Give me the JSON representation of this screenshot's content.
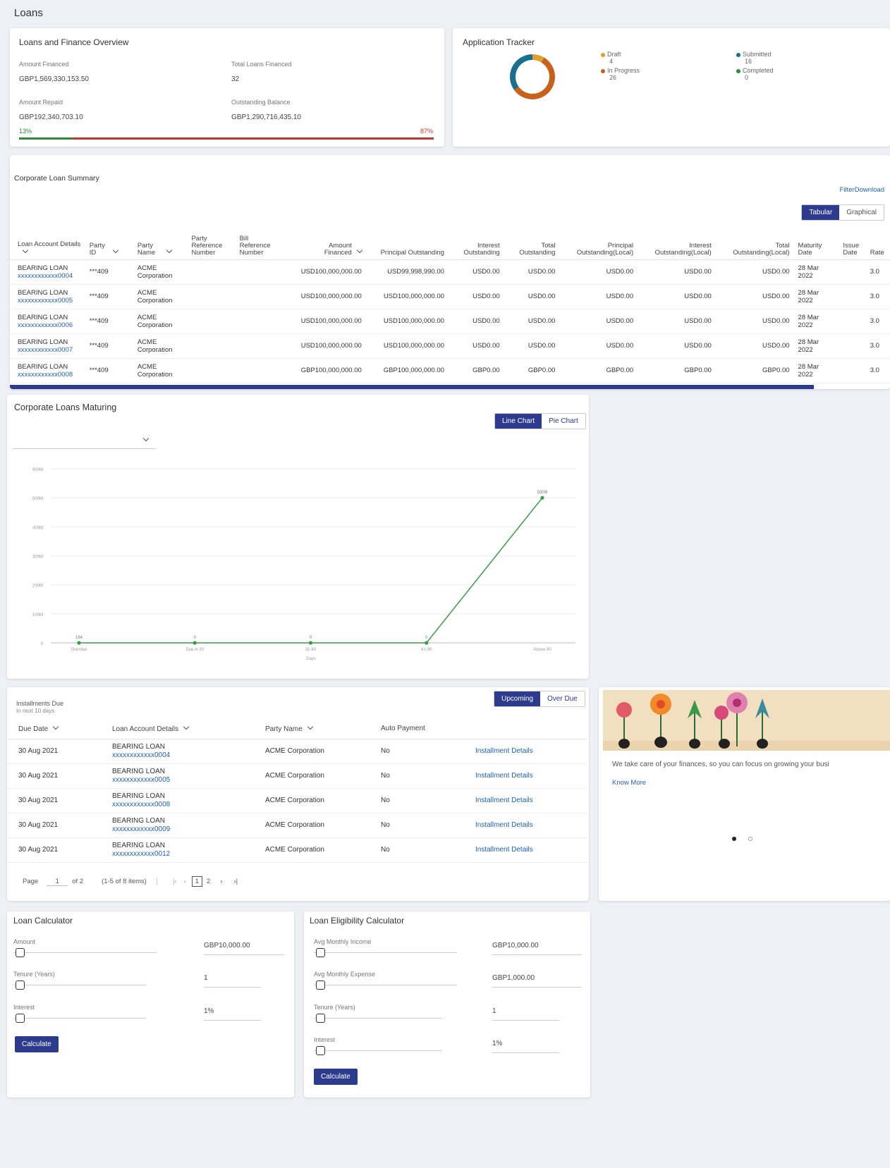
{
  "page": {
    "title": "Loans"
  },
  "overview": {
    "title": "Loans and Finance Overview",
    "amount_financed_label": "Amount Financed",
    "amount_financed": "GBP1,569,330,153.50",
    "total_loans_label": "Total Loans Financed",
    "total_loans": "32",
    "amount_repaid_label": "Amount Repaid",
    "amount_repaid": "GBP192,340,703.10",
    "outstanding_label": "Outstanding Balance",
    "outstanding": "GBP1,290,716,435.10",
    "repaid_pct": "13%",
    "outstanding_pct": "87%",
    "repaid_fraction": 0.13,
    "repaid_color": "#2e8b3a",
    "outstanding_color": "#c0392b"
  },
  "tracker": {
    "title": "Application Tracker",
    "items": [
      {
        "label": "Draft",
        "value": "4",
        "color": "#e0a030",
        "count": 4
      },
      {
        "label": "In Progress",
        "value": "26",
        "color": "#c8621a",
        "count": 26
      },
      {
        "label": "Submitted",
        "value": "16",
        "color": "#1a6f8f",
        "count": 16
      },
      {
        "label": "Completed",
        "value": "0",
        "color": "#2e8b3a",
        "count": 0
      }
    ]
  },
  "summary": {
    "title": "Corporate Loan Summary",
    "filter": "Filter",
    "download": "Download",
    "view_tabular": "Tabular",
    "view_graphical": "Graphical",
    "columns": [
      "Loan Account Details",
      "Party ID",
      "Party Name",
      "Party Reference Number",
      "Bill Reference Number",
      "Amount Financed",
      "Principal Outstanding",
      "Interest Outstanding",
      "Total Outstanding",
      "Principal Outstanding(Local)",
      "Interest Outstanding(Local)",
      "Total Outstanding(Local)",
      "Maturity Date",
      "Issue Date",
      "Rate"
    ],
    "rows": [
      {
        "name": "BEARING LOAN",
        "acct": "xxxxxxxxxxxx0004",
        "party_id": "***409",
        "party_name": "ACME Corporation",
        "amount": "USD100,000,000.00",
        "principal": "USD99,998,990.00",
        "interest": "USD0.00",
        "total": "USD0.00",
        "principal_local": "USD0.00",
        "interest_local": "USD0.00",
        "total_local": "USD0.00",
        "maturity": "28 Mar 2022",
        "rate": "3.0"
      },
      {
        "name": "BEARING LOAN",
        "acct": "xxxxxxxxxxxx0005",
        "party_id": "***409",
        "party_name": "ACME Corporation",
        "amount": "USD100,000,000.00",
        "principal": "USD100,000,000.00",
        "interest": "USD0.00",
        "total": "USD0.00",
        "principal_local": "USD0.00",
        "interest_local": "USD0.00",
        "total_local": "USD0.00",
        "maturity": "28 Mar 2022",
        "rate": "3.0"
      },
      {
        "name": "BEARING LOAN",
        "acct": "xxxxxxxxxxxx0006",
        "party_id": "***409",
        "party_name": "ACME Corporation",
        "amount": "USD100,000,000.00",
        "principal": "USD100,000,000.00",
        "interest": "USD0.00",
        "total": "USD0.00",
        "principal_local": "USD0.00",
        "interest_local": "USD0.00",
        "total_local": "USD0.00",
        "maturity": "28 Mar 2022",
        "rate": "3.0"
      },
      {
        "name": "BEARING LOAN",
        "acct": "xxxxxxxxxxxx0007",
        "party_id": "***409",
        "party_name": "ACME Corporation",
        "amount": "USD100,000,000.00",
        "principal": "USD100,000,000.00",
        "interest": "USD0.00",
        "total": "USD0.00",
        "principal_local": "USD0.00",
        "interest_local": "USD0.00",
        "total_local": "USD0.00",
        "maturity": "28 Mar 2022",
        "rate": "3.0"
      },
      {
        "name": "BEARING LOAN",
        "acct": "xxxxxxxxxxxx0008",
        "party_id": "***409",
        "party_name": "ACME Corporation",
        "amount": "GBP100,000,000.00",
        "principal": "GBP100,000,000.00",
        "interest": "GBP0.00",
        "total": "GBP0.00",
        "principal_local": "GBP0.00",
        "interest_local": "GBP0.00",
        "total_local": "GBP0.00",
        "maturity": "28 Mar 2022",
        "rate": "3.0"
      }
    ]
  },
  "maturing": {
    "title": "Corporate Loans Maturing",
    "line_chart": "Line Chart",
    "pie_chart": "Pie Chart",
    "dropdown_value": ""
  },
  "chart_data": {
    "type": "line",
    "categories": [
      "Overdue",
      "Due in 30",
      "31-60",
      "61-90",
      "Above 90"
    ],
    "values": [
      0.000184,
      0,
      0,
      0,
      500
    ],
    "data_labels": [
      "184",
      "0",
      "0",
      "0",
      "500M"
    ],
    "yticks": [
      "0",
      "100M",
      "200M",
      "300M",
      "400M",
      "500M",
      "600M"
    ],
    "ylim": [
      0,
      600
    ],
    "xlabel": "Days",
    "ylabel": "",
    "series_color": "#3a9a4a",
    "grid": true
  },
  "installments": {
    "title": "Installments Due",
    "subtitle": "In next 10 days",
    "tab_upcoming": "Upcoming",
    "tab_overdue": "Over Due",
    "columns": [
      "Due Date",
      "Loan Account Details",
      "Party Name",
      "Auto Payment"
    ],
    "rows": [
      {
        "date": "30 Aug 2021",
        "name": "BEARING LOAN",
        "acct": "xxxxxxxxxxxx0004",
        "party": "ACME Corporation",
        "auto": "No",
        "link": "Installment Details"
      },
      {
        "date": "30 Aug 2021",
        "name": "BEARING LOAN",
        "acct": "xxxxxxxxxxxx0005",
        "party": "ACME Corporation",
        "auto": "No",
        "link": "Installment Details"
      },
      {
        "date": "30 Aug 2021",
        "name": "BEARING LOAN",
        "acct": "xxxxxxxxxxxx0008",
        "party": "ACME Corporation",
        "auto": "No",
        "link": "Installment Details"
      },
      {
        "date": "30 Aug 2021",
        "name": "BEARING LOAN",
        "acct": "xxxxxxxxxxxx0009",
        "party": "ACME Corporation",
        "auto": "No",
        "link": "Installment Details"
      },
      {
        "date": "30 Aug 2021",
        "name": "BEARING LOAN",
        "acct": "xxxxxxxxxxxx0012",
        "party": "ACME Corporation",
        "auto": "No",
        "link": "Installment Details"
      }
    ],
    "pager": {
      "page_label": "Page",
      "page_value": "1",
      "of": "of 2",
      "items": "(1-5 of 8 items)",
      "pages": [
        "1",
        "2"
      ]
    }
  },
  "promo": {
    "text": "We take care of your finances, so you can focus on growing your busi",
    "link": "Know More"
  },
  "loan_calc": {
    "title": "Loan Calculator",
    "amount_label": "Amount",
    "amount_value": "GBP10,000.00",
    "tenure_label": "Tenure (Years)",
    "tenure_value": "1",
    "interest_label": "Interest",
    "interest_value": "1%",
    "button": "Calculate"
  },
  "elig_calc": {
    "title": "Loan Eligibility Calculator",
    "income_label": "Avg Monthly Income",
    "income_value": "GBP10,000.00",
    "expense_label": "Avg Monthly Expense",
    "expense_value": "GBP1,000.00",
    "tenure_label": "Tenure (Years)",
    "tenure_value": "1",
    "interest_label": "Interest",
    "interest_value": "1%",
    "button": "Calculate"
  }
}
